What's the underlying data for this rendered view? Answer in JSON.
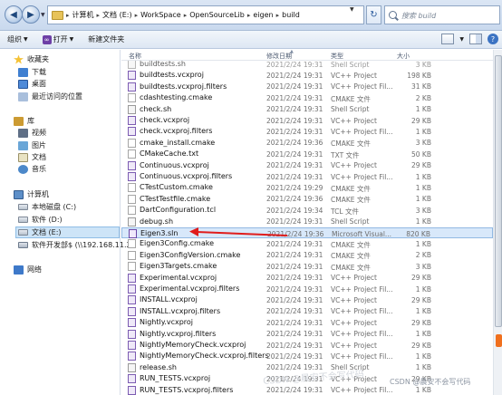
{
  "address": {
    "crumbs": [
      "计算机",
      "文档 (E:)",
      "WorkSpace",
      "OpenSourceLib",
      "eigen",
      "build"
    ],
    "search_placeholder": "搜索 build"
  },
  "toolbar": {
    "organize": "组织",
    "open": "打开",
    "new_folder": "新建文件夹"
  },
  "nav": {
    "favorites": "收藏夹",
    "downloads": "下载",
    "desktop": "桌面",
    "recent": "最近访问的位置",
    "libraries": "库",
    "videos": "视频",
    "pictures": "图片",
    "documents": "文档",
    "music": "音乐",
    "computer": "计算机",
    "drive_c": "本地磁盘 (C:)",
    "drive_d": "软件 (D:)",
    "drive_e": "文档 (E:)",
    "net_drive": "软件开发部$ (\\\\192.168.11.21",
    "network": "网络"
  },
  "columns": {
    "name": "名称",
    "date": "修改日期",
    "type": "类型",
    "size": "大小"
  },
  "files": [
    {
      "name": "buildtests.sh",
      "date": "2021/2/24 19:31",
      "type": "Shell Script",
      "size": "3 KB",
      "icon": "sh"
    },
    {
      "name": "buildtests.vcxproj",
      "date": "2021/2/24 19:31",
      "type": "VC++ Project",
      "size": "198 KB",
      "icon": "vc"
    },
    {
      "name": "buildtests.vcxproj.filters",
      "date": "2021/2/24 19:31",
      "type": "VC++ Project Fil...",
      "size": "31 KB",
      "icon": "vc"
    },
    {
      "name": "cdashtesting.cmake",
      "date": "2021/2/24 19:31",
      "type": "CMAKE 文件",
      "size": "2 KB",
      "icon": "cm"
    },
    {
      "name": "check.sh",
      "date": "2021/2/24 19:31",
      "type": "Shell Script",
      "size": "1 KB",
      "icon": "sh"
    },
    {
      "name": "check.vcxproj",
      "date": "2021/2/24 19:31",
      "type": "VC++ Project",
      "size": "29 KB",
      "icon": "vc"
    },
    {
      "name": "check.vcxproj.filters",
      "date": "2021/2/24 19:31",
      "type": "VC++ Project Fil...",
      "size": "1 KB",
      "icon": "vc"
    },
    {
      "name": "cmake_install.cmake",
      "date": "2021/2/24 19:36",
      "type": "CMAKE 文件",
      "size": "3 KB",
      "icon": "cm"
    },
    {
      "name": "CMakeCache.txt",
      "date": "2021/2/24 19:31",
      "type": "TXT 文件",
      "size": "50 KB",
      "icon": "cm"
    },
    {
      "name": "Continuous.vcxproj",
      "date": "2021/2/24 19:31",
      "type": "VC++ Project",
      "size": "29 KB",
      "icon": "vc"
    },
    {
      "name": "Continuous.vcxproj.filters",
      "date": "2021/2/24 19:31",
      "type": "VC++ Project Fil...",
      "size": "1 KB",
      "icon": "vc"
    },
    {
      "name": "CTestCustom.cmake",
      "date": "2021/2/24 19:29",
      "type": "CMAKE 文件",
      "size": "1 KB",
      "icon": "cm"
    },
    {
      "name": "CTestTestfile.cmake",
      "date": "2021/2/24 19:36",
      "type": "CMAKE 文件",
      "size": "1 KB",
      "icon": "cm"
    },
    {
      "name": "DartConfiguration.tcl",
      "date": "2021/2/24 19:34",
      "type": "TCL 文件",
      "size": "3 KB",
      "icon": "cm"
    },
    {
      "name": "debug.sh",
      "date": "2021/2/24 19:31",
      "type": "Shell Script",
      "size": "1 KB",
      "icon": "sh"
    },
    {
      "name": "Eigen3.sln",
      "date": "2021/2/24 19:36",
      "type": "Microsoft Visual...",
      "size": "820 KB",
      "icon": "sln",
      "selected": true
    },
    {
      "name": "Eigen3Config.cmake",
      "date": "2021/2/24 19:31",
      "type": "CMAKE 文件",
      "size": "1 KB",
      "icon": "cm"
    },
    {
      "name": "Eigen3ConfigVersion.cmake",
      "date": "2021/2/24 19:31",
      "type": "CMAKE 文件",
      "size": "2 KB",
      "icon": "cm"
    },
    {
      "name": "Eigen3Targets.cmake",
      "date": "2021/2/24 19:31",
      "type": "CMAKE 文件",
      "size": "3 KB",
      "icon": "cm"
    },
    {
      "name": "Experimental.vcxproj",
      "date": "2021/2/24 19:31",
      "type": "VC++ Project",
      "size": "29 KB",
      "icon": "vc"
    },
    {
      "name": "Experimental.vcxproj.filters",
      "date": "2021/2/24 19:31",
      "type": "VC++ Project Fil...",
      "size": "1 KB",
      "icon": "vc"
    },
    {
      "name": "INSTALL.vcxproj",
      "date": "2021/2/24 19:31",
      "type": "VC++ Project",
      "size": "29 KB",
      "icon": "vc"
    },
    {
      "name": "INSTALL.vcxproj.filters",
      "date": "2021/2/24 19:31",
      "type": "VC++ Project Fil...",
      "size": "1 KB",
      "icon": "vc"
    },
    {
      "name": "Nightly.vcxproj",
      "date": "2021/2/24 19:31",
      "type": "VC++ Project",
      "size": "29 KB",
      "icon": "vc"
    },
    {
      "name": "Nightly.vcxproj.filters",
      "date": "2021/2/24 19:31",
      "type": "VC++ Project Fil...",
      "size": "1 KB",
      "icon": "vc"
    },
    {
      "name": "NightlyMemoryCheck.vcxproj",
      "date": "2021/2/24 19:31",
      "type": "VC++ Project",
      "size": "29 KB",
      "icon": "vc"
    },
    {
      "name": "NightlyMemoryCheck.vcxproj.filters",
      "date": "2021/2/24 19:31",
      "type": "VC++ Project Fil...",
      "size": "1 KB",
      "icon": "vc"
    },
    {
      "name": "release.sh",
      "date": "2021/2/24 19:31",
      "type": "Shell Script",
      "size": "1 KB",
      "icon": "sh"
    },
    {
      "name": "RUN_TESTS.vcxproj",
      "date": "2021/2/24 19:31",
      "type": "VC++ Project",
      "size": "29 KB",
      "icon": "vc"
    },
    {
      "name": "RUN_TESTS.vcxproj.filters",
      "date": "2021/2/24 19:31",
      "type": "VC++ Project Fil...",
      "size": "1 KB",
      "icon": "vc"
    }
  ],
  "watermark": "CSDN @晨安不会写代码"
}
